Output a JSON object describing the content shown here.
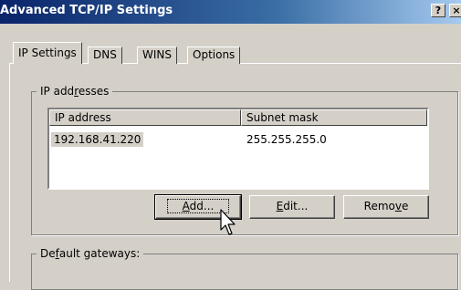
{
  "window": {
    "title": "Advanced TCP/IP Settings",
    "help_button": "?",
    "close_button": "×"
  },
  "tabs": [
    {
      "label": "IP Settings",
      "active": true
    },
    {
      "label": "DNS"
    },
    {
      "label": "WINS"
    },
    {
      "label": "Options"
    }
  ],
  "ip_group": {
    "legend_pre": "IP add",
    "legend_ul": "r",
    "legend_post": "esses",
    "columns": [
      "IP address",
      "Subnet mask"
    ],
    "rows": [
      {
        "ip": "192.168.41.220",
        "mask": "255.255.255.0",
        "selected": true
      }
    ],
    "buttons": {
      "add_ul": "A",
      "add_rest": "dd...",
      "edit_ul": "E",
      "edit_rest": "dit...",
      "remove_pre": "Remo",
      "remove_ul": "v",
      "remove_post": "e"
    }
  },
  "gateway_group": {
    "legend_pre": "De",
    "legend_ul": "f",
    "legend_post": "ault gateways:"
  },
  "colors": {
    "title_bar_start": "#0a246a",
    "title_bar_end": "#a6caf0",
    "face": "#d4d0c8"
  }
}
